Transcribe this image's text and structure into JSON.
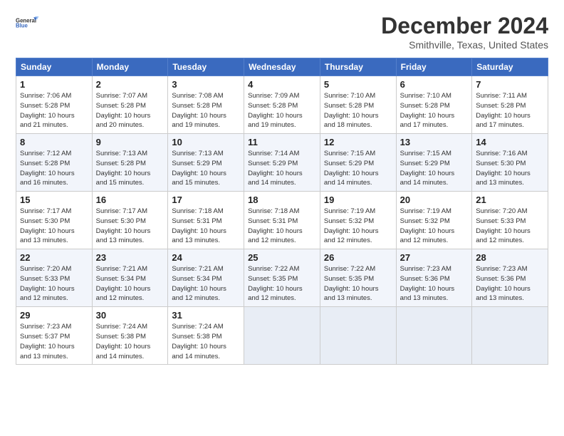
{
  "logo": {
    "line1": "General",
    "line2": "Blue"
  },
  "title": "December 2024",
  "location": "Smithville, Texas, United States",
  "weekdays": [
    "Sunday",
    "Monday",
    "Tuesday",
    "Wednesday",
    "Thursday",
    "Friday",
    "Saturday"
  ],
  "weeks": [
    [
      {
        "day": "1",
        "info": "Sunrise: 7:06 AM\nSunset: 5:28 PM\nDaylight: 10 hours\nand 21 minutes."
      },
      {
        "day": "2",
        "info": "Sunrise: 7:07 AM\nSunset: 5:28 PM\nDaylight: 10 hours\nand 20 minutes."
      },
      {
        "day": "3",
        "info": "Sunrise: 7:08 AM\nSunset: 5:28 PM\nDaylight: 10 hours\nand 19 minutes."
      },
      {
        "day": "4",
        "info": "Sunrise: 7:09 AM\nSunset: 5:28 PM\nDaylight: 10 hours\nand 19 minutes."
      },
      {
        "day": "5",
        "info": "Sunrise: 7:10 AM\nSunset: 5:28 PM\nDaylight: 10 hours\nand 18 minutes."
      },
      {
        "day": "6",
        "info": "Sunrise: 7:10 AM\nSunset: 5:28 PM\nDaylight: 10 hours\nand 17 minutes."
      },
      {
        "day": "7",
        "info": "Sunrise: 7:11 AM\nSunset: 5:28 PM\nDaylight: 10 hours\nand 17 minutes."
      }
    ],
    [
      {
        "day": "8",
        "info": "Sunrise: 7:12 AM\nSunset: 5:28 PM\nDaylight: 10 hours\nand 16 minutes."
      },
      {
        "day": "9",
        "info": "Sunrise: 7:13 AM\nSunset: 5:28 PM\nDaylight: 10 hours\nand 15 minutes."
      },
      {
        "day": "10",
        "info": "Sunrise: 7:13 AM\nSunset: 5:29 PM\nDaylight: 10 hours\nand 15 minutes."
      },
      {
        "day": "11",
        "info": "Sunrise: 7:14 AM\nSunset: 5:29 PM\nDaylight: 10 hours\nand 14 minutes."
      },
      {
        "day": "12",
        "info": "Sunrise: 7:15 AM\nSunset: 5:29 PM\nDaylight: 10 hours\nand 14 minutes."
      },
      {
        "day": "13",
        "info": "Sunrise: 7:15 AM\nSunset: 5:29 PM\nDaylight: 10 hours\nand 14 minutes."
      },
      {
        "day": "14",
        "info": "Sunrise: 7:16 AM\nSunset: 5:30 PM\nDaylight: 10 hours\nand 13 minutes."
      }
    ],
    [
      {
        "day": "15",
        "info": "Sunrise: 7:17 AM\nSunset: 5:30 PM\nDaylight: 10 hours\nand 13 minutes."
      },
      {
        "day": "16",
        "info": "Sunrise: 7:17 AM\nSunset: 5:30 PM\nDaylight: 10 hours\nand 13 minutes."
      },
      {
        "day": "17",
        "info": "Sunrise: 7:18 AM\nSunset: 5:31 PM\nDaylight: 10 hours\nand 13 minutes."
      },
      {
        "day": "18",
        "info": "Sunrise: 7:18 AM\nSunset: 5:31 PM\nDaylight: 10 hours\nand 12 minutes."
      },
      {
        "day": "19",
        "info": "Sunrise: 7:19 AM\nSunset: 5:32 PM\nDaylight: 10 hours\nand 12 minutes."
      },
      {
        "day": "20",
        "info": "Sunrise: 7:19 AM\nSunset: 5:32 PM\nDaylight: 10 hours\nand 12 minutes."
      },
      {
        "day": "21",
        "info": "Sunrise: 7:20 AM\nSunset: 5:33 PM\nDaylight: 10 hours\nand 12 minutes."
      }
    ],
    [
      {
        "day": "22",
        "info": "Sunrise: 7:20 AM\nSunset: 5:33 PM\nDaylight: 10 hours\nand 12 minutes."
      },
      {
        "day": "23",
        "info": "Sunrise: 7:21 AM\nSunset: 5:34 PM\nDaylight: 10 hours\nand 12 minutes."
      },
      {
        "day": "24",
        "info": "Sunrise: 7:21 AM\nSunset: 5:34 PM\nDaylight: 10 hours\nand 12 minutes."
      },
      {
        "day": "25",
        "info": "Sunrise: 7:22 AM\nSunset: 5:35 PM\nDaylight: 10 hours\nand 12 minutes."
      },
      {
        "day": "26",
        "info": "Sunrise: 7:22 AM\nSunset: 5:35 PM\nDaylight: 10 hours\nand 13 minutes."
      },
      {
        "day": "27",
        "info": "Sunrise: 7:23 AM\nSunset: 5:36 PM\nDaylight: 10 hours\nand 13 minutes."
      },
      {
        "day": "28",
        "info": "Sunrise: 7:23 AM\nSunset: 5:36 PM\nDaylight: 10 hours\nand 13 minutes."
      }
    ],
    [
      {
        "day": "29",
        "info": "Sunrise: 7:23 AM\nSunset: 5:37 PM\nDaylight: 10 hours\nand 13 minutes."
      },
      {
        "day": "30",
        "info": "Sunrise: 7:24 AM\nSunset: 5:38 PM\nDaylight: 10 hours\nand 14 minutes."
      },
      {
        "day": "31",
        "info": "Sunrise: 7:24 AM\nSunset: 5:38 PM\nDaylight: 10 hours\nand 14 minutes."
      },
      null,
      null,
      null,
      null
    ]
  ]
}
